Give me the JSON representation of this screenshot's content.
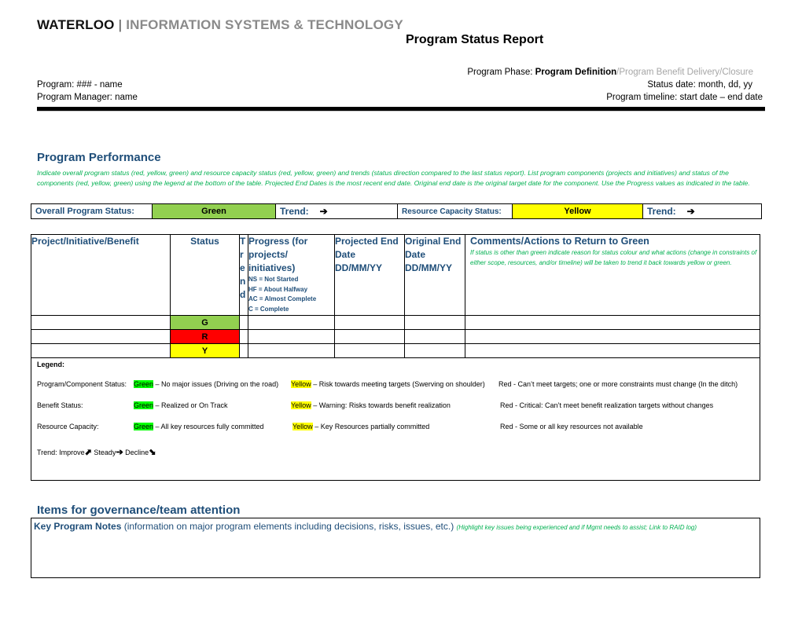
{
  "brand": {
    "primary": "WATERLOO",
    "separator": "|",
    "secondary": "INFORMATION SYSTEMS & TECHNOLOGY"
  },
  "title": "Program Status Report",
  "meta": {
    "phase_label": "Program Phase:",
    "phase_current": "Program Definition",
    "phase_rest": "/Program Benefit Delivery/Closure",
    "program": "Program:  ### - name",
    "manager": "Program Manager: name",
    "status_date": "Status date:  month, dd, yy",
    "timeline": "Program timeline:   start date   –   end date"
  },
  "performance": {
    "heading": "Program Performance",
    "instructions": "Indicate overall program status (red, yellow, green) and resource capacity status (red, yellow, green) and trends (status direction compared to the last status report).  List program components (projects and initiatives) and status of the components (red, yellow, green) using the legend at the bottom of the table. Projected End Dates is the most recent end date.  Original end date is the original target date for the component.  Use the Progress values as indicated in the table.",
    "overall": {
      "label": "Overall Program Status:",
      "value": "Green",
      "trend_label": "Trend:",
      "trend_arrow": "➔",
      "resource_label": "Resource Capacity Status:",
      "resource_value": "Yellow",
      "resource_trend_label": "Trend:",
      "resource_trend_arrow": "➔"
    },
    "colors": {
      "green": "#92d050",
      "yellow": "#ffff00",
      "red": "#ff0000",
      "heading_blue": "#1f4e79",
      "instruction_green": "#00b050"
    }
  },
  "table": {
    "headers": {
      "project": "Project/Initiative/Benefit",
      "status": "Status",
      "trend": "Trend",
      "progress": "Progress (for projects/ initiatives)",
      "progress_legend": [
        "NS = Not Started",
        "HF = About Halfway",
        "AC = Almost Complete",
        "C = Complete"
      ],
      "projected": "Projected End Date DD/MM/YY",
      "original": "Original End Date DD/MM/YY",
      "comments": "Comments/Actions to Return to Green",
      "comments_instructions": "If status is other than green indicate reason for status colour and what actions (change in constraints of either scope, resources, and/or timeline) will be taken to trend it back towards yellow or green."
    },
    "rows": [
      {
        "project": "",
        "status": "G",
        "trend": "",
        "progress": "",
        "projected": "",
        "original": "",
        "comments": ""
      },
      {
        "project": "",
        "status": "R",
        "trend": "",
        "progress": "",
        "projected": "",
        "original": "",
        "comments": ""
      },
      {
        "project": "",
        "status": "Y",
        "trend": "",
        "progress": "",
        "projected": "",
        "original": "",
        "comments": ""
      }
    ]
  },
  "legend": {
    "title": "Legend:",
    "rows": [
      {
        "label": "Program/Component Status:",
        "green": "Green",
        "green_text": " –  No major issues (Driving on the road)",
        "yellow": "Yellow",
        "yellow_text": " – Risk towards meeting targets (Swerving on shoulder)",
        "red": "Red",
        "red_text": "  - Can’t meet targets; one or more constraints must change (In the ditch)"
      },
      {
        "label": "Benefit Status:",
        "green": "Green",
        "green_text": " – Realized or On Track",
        "yellow": "Yellow",
        "yellow_text": " – Warning: Risks towards benefit realization",
        "red": "Red",
        "red_text": "  - Critical: Can’t meet benefit realization targets without changes"
      },
      {
        "label": "Resource Capacity:",
        "green": "Green",
        "green_text": " – All key resources fully committed",
        "yellow": "Yellow",
        "yellow_text": " – Key Resources partially committed",
        "red": "Red",
        "red_text": "  - Some or all key resources not available"
      }
    ],
    "trend": {
      "label": "Trend: Improve",
      "improve_icon": "⬈",
      "steady": " Steady",
      "steady_icon": "➔",
      "decline": " Decline",
      "decline_icon": "⬊"
    }
  },
  "governance": {
    "heading": "Items for governance/team attention",
    "notes_title": "Key Program Notes",
    "notes_desc": " (information on major program elements including decisions, risks, issues, etc.) ",
    "notes_instructions": "(Highlight key issues being experienced and if Mgmt needs to assist;  Link to RAID log)"
  }
}
